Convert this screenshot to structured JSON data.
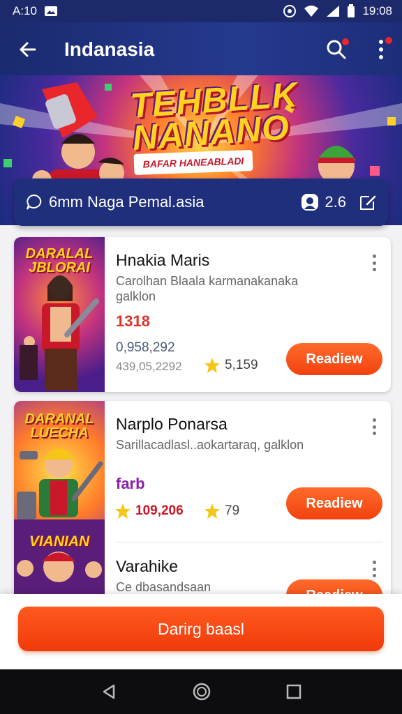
{
  "status_bar": {
    "time_left": "A:10",
    "time_right": "19:08"
  },
  "app_bar": {
    "title": "Indanasia"
  },
  "banner": {
    "title": "TEHBLLK NANANO",
    "subtitle": "BAFAR HANEABLADI"
  },
  "info_card": {
    "text": "6mm Naga Pemal.asia",
    "rating": "2.6"
  },
  "items": [
    {
      "thumb_title": "DARALAL JBLORAI",
      "title": "Hnakia Maris",
      "description": "Carolhan Blaala karmanakanaka galklon",
      "price": "1318",
      "number": "0,958,292",
      "number2": "439,05,2292",
      "stars": "5,159",
      "button": "Readiew"
    },
    {
      "thumb_title": "DARANAL LUECHA",
      "thumb_title2": "VIANIAN",
      "title": "Narplo Ponarsa",
      "description": "Sarillacadlasl..aokartaraq, galklon",
      "price": "farb",
      "number": "109,206",
      "stars": "79",
      "button": "Readiew"
    },
    {
      "title": "Varahike",
      "description": "Ce dbasandsaan",
      "button": "Readiew"
    }
  ],
  "bottom_button": "Darirg baasl",
  "colors": {
    "primary": "#1b2a6e",
    "accent": "#f2420f",
    "price_red": "#e0302a",
    "price_purple": "#8a1ea8"
  }
}
